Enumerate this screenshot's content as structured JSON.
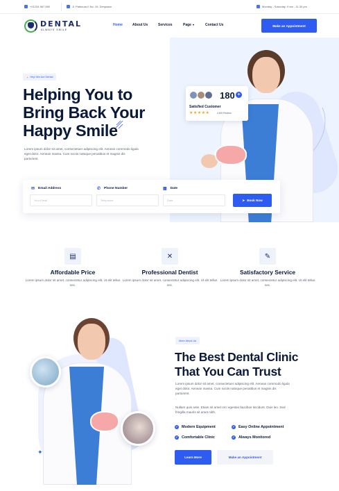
{
  "topbar": {
    "phone": "+01234 567 890",
    "address": "Jl. Patimura II No. 19, Denpasar",
    "hours": "Monday - Saturday: 9 am - 11.30 pm"
  },
  "brand": {
    "name": "DENTAL",
    "tagline": "ALWAYS SMILE"
  },
  "nav": {
    "items": [
      "Home",
      "About Us",
      "Services",
      "Page",
      "Contact Us"
    ],
    "cta": "Make an Appointment"
  },
  "hero": {
    "badge": "Hey! We Are Dental",
    "title_lines": [
      "Helping You to",
      "Bring Back Your",
      "Happy Smile"
    ],
    "description": "Lorem ipsum dolor sit amet, consectetuer adipiscing elit. Aenean commodo ligula eget dolor. Aenean massa. Cum sociis natoque penatibus et magnis dis parturient.",
    "rating": {
      "count": "180",
      "plus": "+",
      "label": "Satisfied Customer",
      "stars": "★★★★★",
      "reviews": "4.8/5 Review"
    }
  },
  "booking": {
    "email_label": "Email Address",
    "email_placeholder": "Your Email",
    "phone_label": "Phone Number",
    "phone_placeholder": "Telephone",
    "date_label": "Date",
    "date_placeholder": "Date",
    "button": "Book Now"
  },
  "features": [
    {
      "title": "Affordable Price",
      "desc": "Lorem ipsum dolor sit amet, consectetur adipiscing elit. Ut elit tellus nec."
    },
    {
      "title": "Professional Dentist",
      "desc": "Lorem ipsum dolor sit amet, consectetur adipiscing elit. Ut elit tellus nec."
    },
    {
      "title": "Satisfactory Service",
      "desc": "Lorem ipsum dolor sit amet, consectetur adipiscing elit. Ut elit tellus nec."
    }
  ],
  "about": {
    "badge": "More About Us",
    "title_lines": [
      "The Best Dental Clinic",
      "That You Can Trust"
    ],
    "p1": "Lorem ipsum dolor sit amet, consectetuer adipiscing elit. Aenean commodo ligula eget dolor. Aenean massa. Cum sociis natoque penatibus et magnis dis parturient.",
    "p2": "Nullam quis ante. Etiam sit amet orci egestas faucibus tincidunt. Duis leo. Sed fringilla mauris sit amet nibh.",
    "checks": [
      "Modern Equipment",
      "Easy Online Appointment",
      "Comfortable Clinic",
      "Always Monitored"
    ],
    "learn_more": "Learn More",
    "appointment": "Make an Appointment"
  },
  "colors": {
    "accent": "#2f5cf0",
    "navy": "#0b1a3a",
    "logo_green": "#40b24a"
  }
}
